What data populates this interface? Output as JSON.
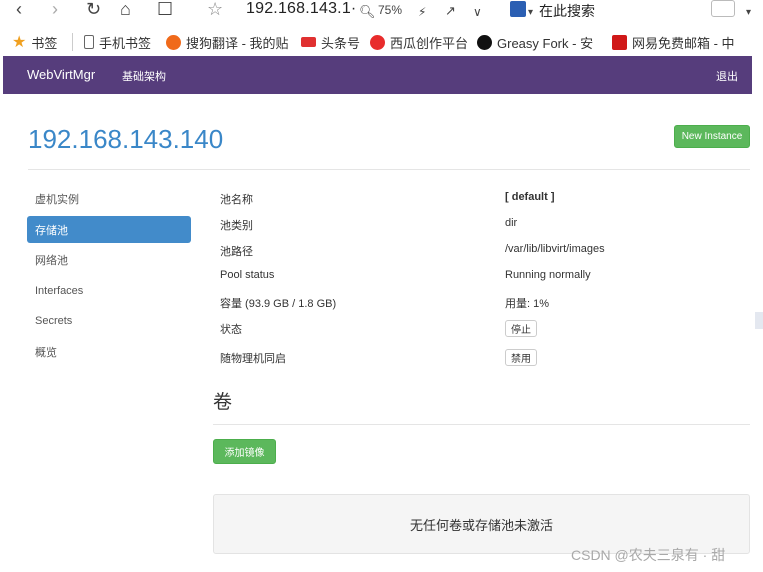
{
  "browser": {
    "address": "192.168.143.1·",
    "zoom": "75%",
    "search_placeholder": "在此搜索",
    "icons": {
      "back": "back-arrow-icon",
      "forward": "forward-arrow-icon",
      "reload": "reload-icon",
      "home": "home-icon",
      "reading": "reader-icon",
      "star": "star-icon"
    }
  },
  "bookmarks": [
    {
      "label": "书签",
      "icon": "star-icon",
      "color": "#f0a020"
    },
    {
      "label": "手机书签",
      "icon": "phone-icon",
      "color": "#666666"
    },
    {
      "label": "搜狗翻译 - 我的贴",
      "icon": "sogou-icon",
      "color": "#f06a1a"
    },
    {
      "label": "头条号",
      "icon": "toutiao-icon",
      "color": "#e03030"
    },
    {
      "label": "西瓜创作平台",
      "icon": "xigua-icon",
      "color": "#e82c2c"
    },
    {
      "label": "Greasy Fork - 安",
      "icon": "greasyfork-icon",
      "color": "#111111"
    },
    {
      "label": "网易免费邮箱 - 中",
      "icon": "netease-icon",
      "color": "#d01818"
    }
  ],
  "navbar": {
    "brand": "WebVirtMgr",
    "infrastructure": "基础架构",
    "logout": "退出",
    "color": "#563d7c"
  },
  "page": {
    "title": "192.168.143.140",
    "new_instance": "New Instance"
  },
  "sidebar": {
    "items": [
      {
        "label": "虚机实例",
        "active": false
      },
      {
        "label": "存储池",
        "active": true
      },
      {
        "label": "网络池",
        "active": false
      },
      {
        "label": "Interfaces",
        "active": false
      },
      {
        "label": "Secrets",
        "active": false
      },
      {
        "label": "概览",
        "active": false
      }
    ]
  },
  "pool": {
    "rows": [
      {
        "label": "池名称",
        "value": "[ default ]"
      },
      {
        "label": "池类别",
        "value": "dir"
      },
      {
        "label": "池路径",
        "value": "/var/lib/libvirt/images"
      },
      {
        "label": "Pool status",
        "value": "Running normally"
      },
      {
        "label": "容量 (93.9 GB / 1.8 GB)",
        "value": "用量: 1%"
      }
    ],
    "state_label": "状态",
    "state_button": "停止",
    "autostart_label": "随物理机同启",
    "autostart_button": "禁用"
  },
  "volumes": {
    "heading": "卷",
    "add_button": "添加镜像",
    "empty_text": "无任何卷或存储池未激活"
  },
  "watermark": "CSDN @农夫三泉有 · 甜"
}
